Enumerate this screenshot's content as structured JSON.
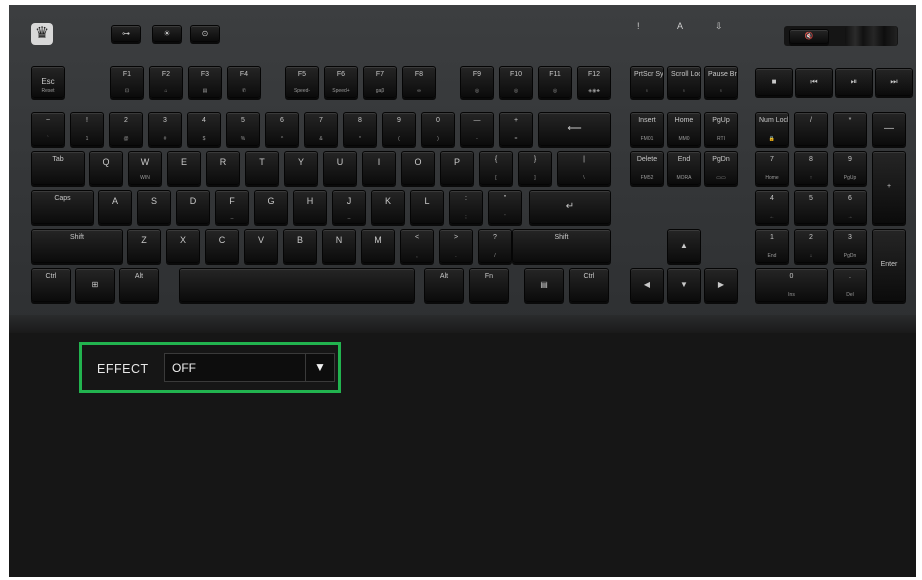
{
  "keyboard": {
    "logo_icon": "tt-dragon-logo-icon",
    "indicators": [
      "!",
      "A",
      "⇩"
    ],
    "media_keys": [
      "■",
      "⏮",
      "⏯",
      "⏭"
    ],
    "volume_icon": "mute-icon"
  },
  "keys": {
    "esc": {
      "p": "Esc",
      "s": "Reset"
    },
    "f1": {
      "p": "F1",
      "s": "⊡"
    },
    "f2": {
      "p": "F2",
      "s": "⌂"
    },
    "f3": {
      "p": "F3",
      "s": "▤"
    },
    "f4": {
      "p": "F4",
      "s": "✆"
    },
    "f5": {
      "p": "F5",
      "s": "Speed-"
    },
    "f6": {
      "p": "F6",
      "s": "Speed+"
    },
    "f7": {
      "p": "F7",
      "s": "gaβ"
    },
    "f8": {
      "p": "F8",
      "s": "∞"
    },
    "f9": {
      "p": "F9",
      "s": "◎"
    },
    "f10": {
      "p": "F10",
      "s": "◎"
    },
    "f11": {
      "p": "F11",
      "s": "◎"
    },
    "f12": {
      "p": "F12",
      "s": "◈◉♣"
    },
    "prtsc": {
      "p": "PrtScr SysRq",
      "s": "♁"
    },
    "scrlk": {
      "p": "Scroll Lock",
      "s": "♁"
    },
    "pause": {
      "p": "Pause Break",
      "s": "♁"
    },
    "tilde": {
      "p": "~",
      "s": "`"
    },
    "n1": {
      "p": "!",
      "s": "1"
    },
    "n2": {
      "p": "2",
      "s": "@"
    },
    "n3": {
      "p": "3",
      "s": "#"
    },
    "n4": {
      "p": "4",
      "s": "$"
    },
    "n5": {
      "p": "5",
      "s": "%"
    },
    "n6": {
      "p": "6",
      "s": "^"
    },
    "n7": {
      "p": "7",
      "s": "&"
    },
    "n8": {
      "p": "8",
      "s": "*"
    },
    "n9": {
      "p": "9",
      "s": "("
    },
    "n0": {
      "p": "0",
      "s": ")"
    },
    "minus": {
      "p": "—",
      "s": "-"
    },
    "plus": {
      "p": "+",
      "s": "="
    },
    "bksp": {
      "p": "⟵"
    },
    "ins": {
      "p": "Insert",
      "s": "FM01"
    },
    "home": {
      "p": "Home",
      "s": "MM0"
    },
    "pgup": {
      "p": "PgUp",
      "s": "RTI"
    },
    "numlk": {
      "p": "Num Lock",
      "s": "🔒"
    },
    "ndiv": {
      "p": "/"
    },
    "nmul": {
      "p": "*"
    },
    "nsub": {
      "p": "—"
    },
    "tab": {
      "p": "Tab"
    },
    "q": {
      "p": "Q"
    },
    "w": {
      "p": "W",
      "s": "WIN"
    },
    "e": {
      "p": "E"
    },
    "r": {
      "p": "R"
    },
    "t": {
      "p": "T"
    },
    "y": {
      "p": "Y"
    },
    "u": {
      "p": "U"
    },
    "i": {
      "p": "I"
    },
    "o": {
      "p": "O"
    },
    "pp": {
      "p": "P"
    },
    "lbr": {
      "p": "{",
      "s": "["
    },
    "rbr": {
      "p": "}",
      "s": "]"
    },
    "bsl": {
      "p": "|",
      "s": "\\"
    },
    "del": {
      "p": "Delete",
      "s": "FM52"
    },
    "end": {
      "p": "End",
      "s": "MORA"
    },
    "pgdn": {
      "p": "PgDn",
      "s": "▭▭"
    },
    "n7k": {
      "p": "7",
      "s": "Home"
    },
    "n8k": {
      "p": "8",
      "s": "↑"
    },
    "n9k": {
      "p": "9",
      "s": "PgUp"
    },
    "nadd": {
      "p": "+"
    },
    "caps": {
      "p": "Caps"
    },
    "a": {
      "p": "A"
    },
    "ss": {
      "p": "S"
    },
    "d": {
      "p": "D"
    },
    "f": {
      "p": "F",
      "s": "_"
    },
    "g": {
      "p": "G"
    },
    "h": {
      "p": "H"
    },
    "j": {
      "p": "J",
      "s": "_"
    },
    "k": {
      "p": "K"
    },
    "l": {
      "p": "L"
    },
    "semi": {
      "p": ":",
      "s": ";"
    },
    "quote": {
      "p": "\"",
      "s": "'"
    },
    "enter": {
      "p": "↵"
    },
    "n4k": {
      "p": "4",
      "s": "←"
    },
    "n5k": {
      "p": "5"
    },
    "n6k": {
      "p": "6",
      "s": "→"
    },
    "lshift": {
      "p": "Shift"
    },
    "z": {
      "p": "Z"
    },
    "x": {
      "p": "X"
    },
    "c": {
      "p": "C"
    },
    "v": {
      "p": "V"
    },
    "b": {
      "p": "B"
    },
    "n": {
      "p": "N"
    },
    "m": {
      "p": "M"
    },
    "comma": {
      "p": "<",
      "s": ","
    },
    "dot": {
      "p": ">",
      "s": "."
    },
    "slash": {
      "p": "?",
      "s": "/"
    },
    "rshift": {
      "p": "Shift"
    },
    "up": {
      "p": "▲"
    },
    "n1k": {
      "p": "1",
      "s": "End"
    },
    "n2k": {
      "p": "2",
      "s": "↓"
    },
    "n3k": {
      "p": "3",
      "s": "PgDn"
    },
    "nent": {
      "p": "Enter"
    },
    "lctrl": {
      "p": "Ctrl"
    },
    "win": {
      "p": "⊞"
    },
    "lalt": {
      "p": "Alt"
    },
    "space": {
      "p": ""
    },
    "ralt": {
      "p": "Alt"
    },
    "fn": {
      "p": "Fn"
    },
    "menu": {
      "p": "▤"
    },
    "rctrl": {
      "p": "Ctrl"
    },
    "left": {
      "p": "◀"
    },
    "down": {
      "p": "▼"
    },
    "right": {
      "p": "▶"
    },
    "n0k": {
      "p": "0",
      "s": "Ins"
    },
    "ndot": {
      "p": ".",
      "s": "Del"
    },
    "tb1": {
      "p": "⊶"
    },
    "tb2": {
      "p": "☀"
    },
    "tb3": {
      "p": "⊙"
    }
  },
  "effect": {
    "label": "EFFECT",
    "value": "OFF",
    "arrow": "▼"
  },
  "colors": {
    "highlight": "#22b34f",
    "keyboard_body": "#3a3c3e",
    "background": "#161616"
  }
}
